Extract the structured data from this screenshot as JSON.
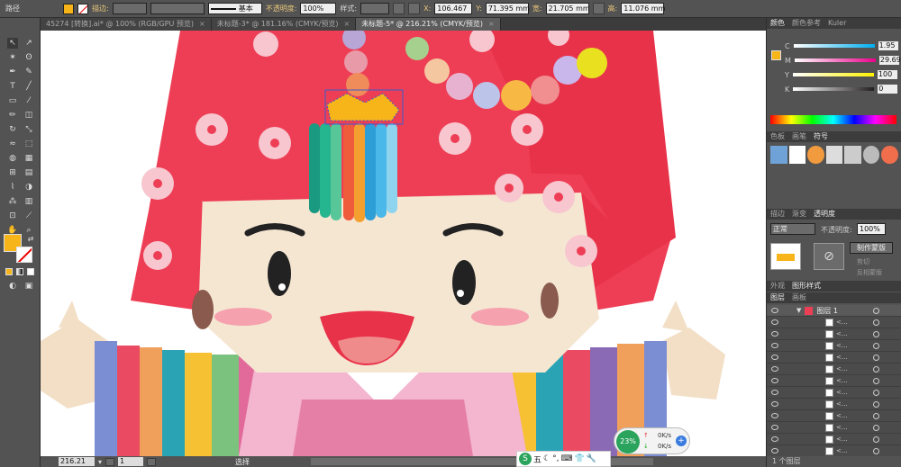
{
  "control_bar": {
    "mode_label": "路径",
    "stroke_label": "描边:",
    "brush_label": "基本",
    "opacity_label": "不透明度:",
    "opacity_value": "100%",
    "style_label": "样式:",
    "x_label": "X:",
    "x_value": "106.467",
    "y_label": "Y:",
    "y_value": "71.395 mm",
    "w_label": "宽:",
    "w_value": "21.705 mm",
    "h_label": "高:",
    "h_value": "11.076 mm"
  },
  "tabs": [
    {
      "label": "45274 [转换].ai* @ 100% (RGB/GPU 预览)",
      "close": "×",
      "active": false
    },
    {
      "label": "未标题-3* @ 181.16% (CMYK/预览)",
      "close": "×",
      "active": false
    },
    {
      "label": "未标题-5* @ 216.21% (CMYK/预览)",
      "close": "×",
      "active": true
    }
  ],
  "status_bar": {
    "zoom": "216.21",
    "page": "1",
    "tool_name": "选择"
  },
  "color_panel": {
    "tabs": [
      "颜色",
      "颜色参考",
      "Kuler"
    ],
    "channels": [
      {
        "label": "C",
        "value": "1.95",
        "unit": "%",
        "color": "#00aeef"
      },
      {
        "label": "M",
        "value": "29.69",
        "unit": "%",
        "color": "#ec008c"
      },
      {
        "label": "Y",
        "value": "100",
        "unit": "%",
        "color": "#fff200"
      },
      {
        "label": "K",
        "value": "0",
        "unit": "%",
        "color": "#231f20"
      }
    ],
    "fill_color": "#f7b51a"
  },
  "swatch_panel": {
    "tabs": [
      "色板",
      "画笔",
      "符号"
    ]
  },
  "transparency_panel": {
    "tabs": [
      "描边",
      "渐变",
      "透明度"
    ],
    "blend_mode": "正常",
    "opacity_label": "不透明度:",
    "opacity_value": "100%",
    "mask_button": "制作蒙版",
    "clip_label": "剪切",
    "invert_label": "反相蒙版"
  },
  "appearance_panel": {
    "tabs": [
      "外观",
      "图形样式"
    ]
  },
  "layers_panel": {
    "tabs": [
      "图层",
      "画板"
    ],
    "layer_name": "图层 1",
    "sublayer_label": "<...",
    "footer": "1 个图层"
  },
  "netspeed": {
    "percent": "23%",
    "up": "0K/s",
    "down": "0K/s"
  },
  "taskbar": {
    "ime": "五"
  }
}
